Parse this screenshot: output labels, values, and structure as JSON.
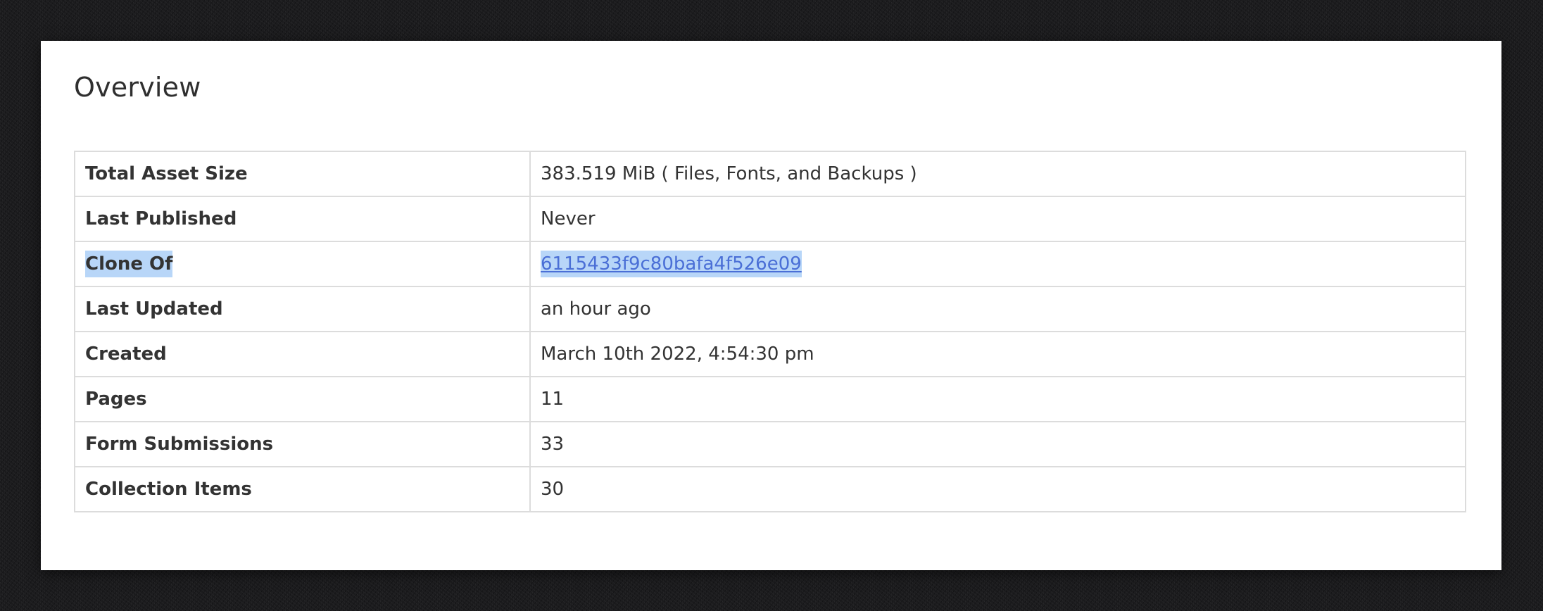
{
  "overview": {
    "title": "Overview",
    "rows": [
      {
        "label": "Total Asset Size",
        "value": "383.519 MiB ( Files, Fonts, and Backups )"
      },
      {
        "label": "Last Published",
        "value": "Never"
      },
      {
        "label": "Clone Of",
        "value": "6115433f9c80bafa4f526e09",
        "is_link": true,
        "selected": true
      },
      {
        "label": "Last Updated",
        "value": "an hour ago"
      },
      {
        "label": "Created",
        "value": "March 10th 2022, 4:54:30 pm"
      },
      {
        "label": "Pages",
        "value": "11"
      },
      {
        "label": "Form Submissions",
        "value": "33"
      },
      {
        "label": "Collection Items",
        "value": "30"
      }
    ]
  },
  "colors": {
    "link": "#4a6fd6",
    "selection": "#b8d6f8",
    "border": "#dcdcdc",
    "text": "#333333"
  }
}
